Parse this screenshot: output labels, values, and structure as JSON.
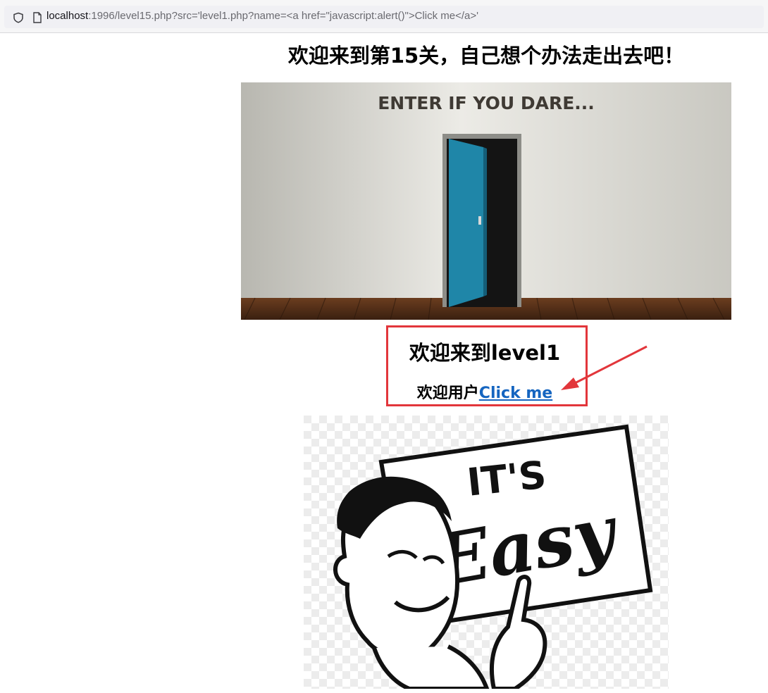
{
  "browser": {
    "url_host": "localhost",
    "url_rest": ":1996/level15.php?src='level1.php?name=<a href=\"javascript:alert()\">Click me</a>'"
  },
  "page": {
    "title": "欢迎来到第15关，自己想个办法走出去吧！",
    "door_sign": "ENTER IF YOU DARE...",
    "include": {
      "heading": "欢迎来到level1",
      "user_prefix": "欢迎用户",
      "link_text": "Click me"
    },
    "easy_sign": {
      "line1": "IT'S",
      "line2": "Easy"
    }
  },
  "colors": {
    "annotation_red": "#e2363b",
    "link_blue": "#1565c0",
    "door_teal": "#1f86a8"
  }
}
